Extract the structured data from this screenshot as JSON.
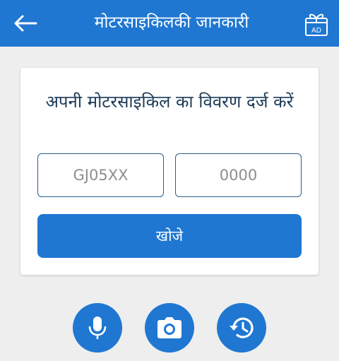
{
  "appbar": {
    "title": "मोटरसाइकिलकी जानकारी",
    "back_icon": "arrow-left-icon",
    "gift_icon": "gift-ad-icon",
    "gift_badge": "AD"
  },
  "card": {
    "heading": "अपनी मोटरसाइकिल का विवरण दर्ज करें",
    "reg_field": {
      "value": "",
      "placeholder": "GJ05XX"
    },
    "num_field": {
      "value": "",
      "placeholder": "0000"
    },
    "search_label": "खोजे"
  },
  "actions": [
    {
      "icon": "microphone-icon"
    },
    {
      "icon": "camera-icon"
    },
    {
      "icon": "history-icon"
    }
  ],
  "colors": {
    "primary": "#1f77d2",
    "background": "#eeeeee",
    "heading_text": "#1b3a57",
    "field_border": "#2a5e8c"
  }
}
